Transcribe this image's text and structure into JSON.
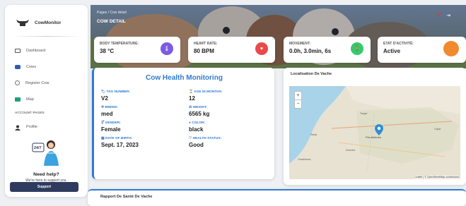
{
  "app": {
    "name": "CowMonitor"
  },
  "sidebar": {
    "items": [
      {
        "label": "Dashboard",
        "icon": "dashboard-icon"
      },
      {
        "label": "Cows",
        "icon": "cow-icon"
      },
      {
        "label": "Register Cow",
        "icon": "register-icon"
      },
      {
        "label": "Map",
        "icon": "map-icon"
      }
    ],
    "section_title": "ACCOUNT PAGES",
    "account_items": [
      {
        "label": "Profile",
        "icon": "user-icon"
      }
    ],
    "help": {
      "badge": "24/7",
      "title": "Need help?",
      "subtitle": "We're here to support you.",
      "button": "Support"
    }
  },
  "header": {
    "breadcrumb": "Pages / Cow detail",
    "title": "COW DETAIL"
  },
  "stats": [
    {
      "label": "BODY TEMPERATURE:",
      "value": "38 °C",
      "icon": "thermometer-icon",
      "color": "#7b5ce1"
    },
    {
      "label": "HEART RATE:",
      "value": "80 BPM",
      "icon": "heart-icon",
      "color": "#e84a4a"
    },
    {
      "label": "MOVEMENT:",
      "value": "0.0h, 3.0min, 6s",
      "icon": "walk-icon",
      "color": "#3ac76b"
    },
    {
      "label": "ETAT D'ACTIVITÉ:",
      "value": "Active",
      "icon": "activity-dot-icon",
      "color": "#f08a2e"
    }
  ],
  "health": {
    "title": "Cow Health Monitoring",
    "fields": [
      {
        "label": "TAG NUMBER:",
        "value": "V2"
      },
      {
        "label": "AGE IN MONTHS:",
        "value": "12"
      },
      {
        "label": "BREED:",
        "value": "med"
      },
      {
        "label": "WEIGHT:",
        "value": "6565 kg"
      },
      {
        "label": "GENDER:",
        "value": "Female"
      },
      {
        "label": "COLOR:",
        "value": "black"
      },
      {
        "label": "DATE OF BIRTH:",
        "value": "Sept. 17, 2023"
      },
      {
        "label": "HEALTH STATUS:",
        "value": "Good"
      }
    ]
  },
  "map": {
    "title": "Localisation De Vache",
    "zoom_in": "+",
    "zoom_out": "−",
    "credit": "Leaflet | © OpenStreetMap contributors",
    "marker_city": "Fès-Meknès"
  },
  "report": {
    "title": "Rapport De Santé De Vache"
  },
  "accent": "#2f7bd4"
}
